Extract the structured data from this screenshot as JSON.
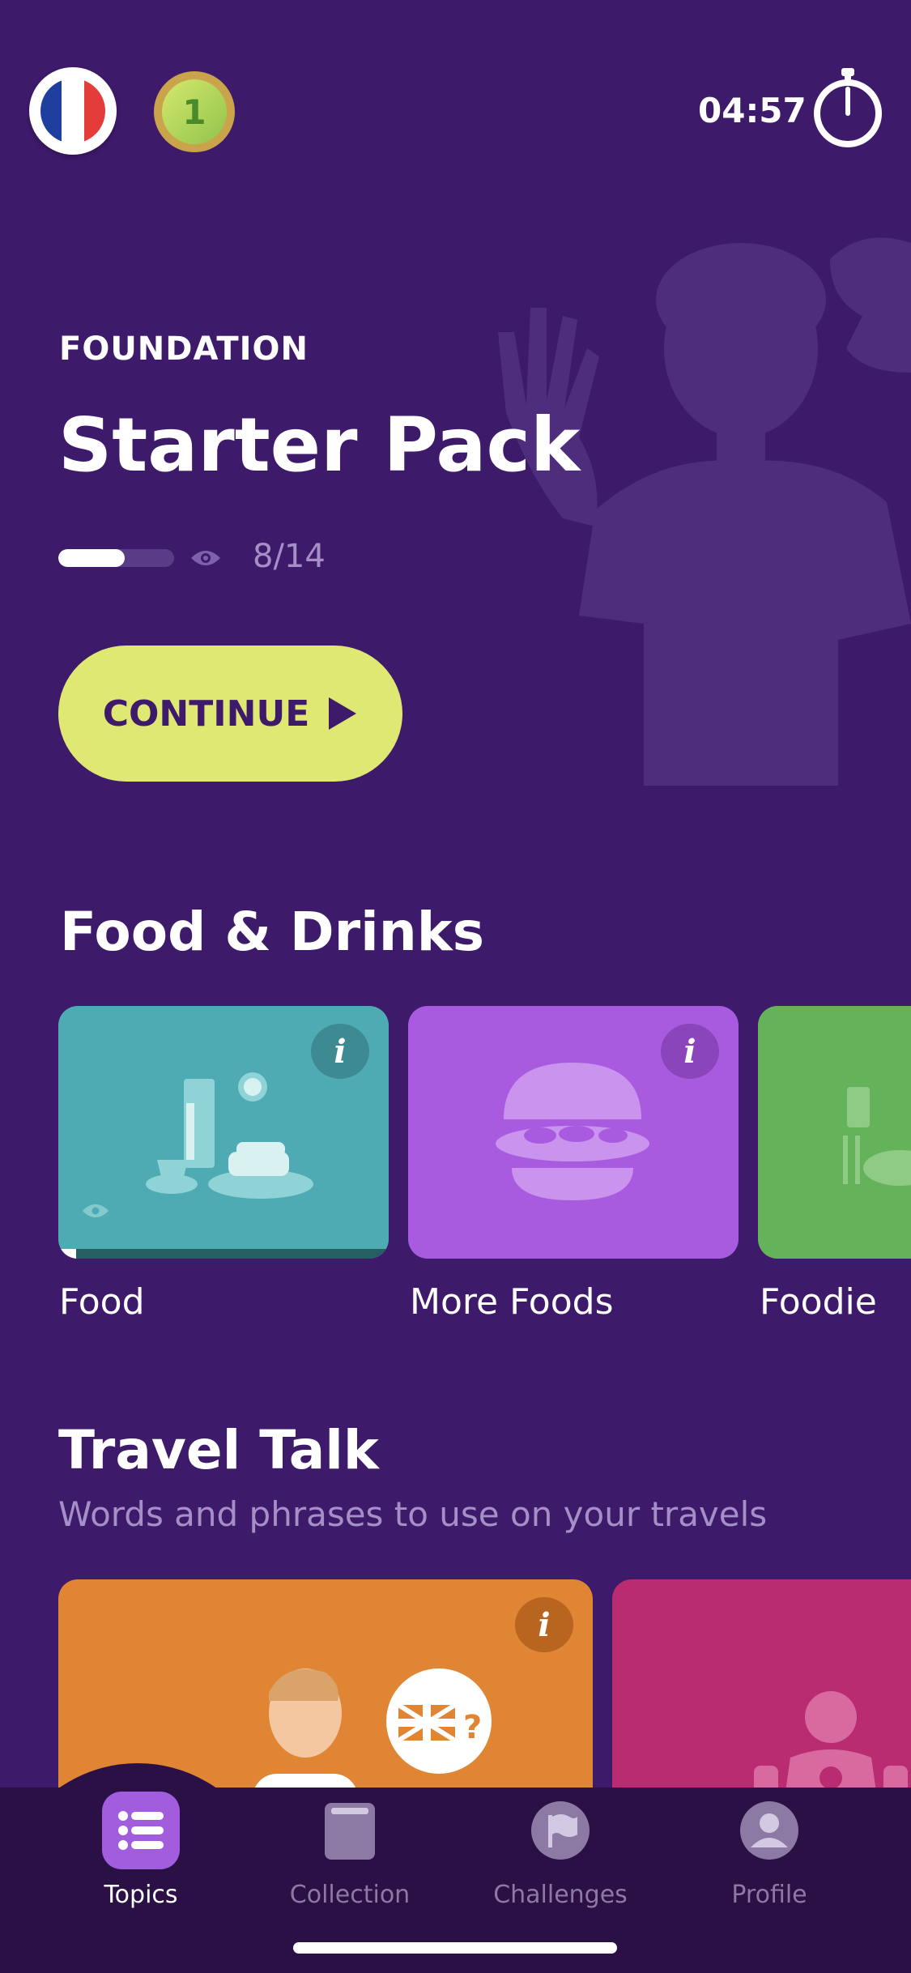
{
  "header": {
    "flag_icon": "france-flag-icon",
    "level_badge": "1",
    "timer": "04:57",
    "timer_icon": "stopwatch-icon"
  },
  "hero": {
    "kicker": "FOUNDATION",
    "title": "Starter Pack",
    "progress_text": "8/14",
    "progress_fraction": 0.57,
    "continue_label": "CONTINUE"
  },
  "food_section": {
    "title": "Food & Drinks",
    "cards": [
      {
        "label": "Food",
        "color": "#4eabb3"
      },
      {
        "label": "More Foods",
        "color": "#a95be0"
      },
      {
        "label": "Foodie",
        "color": "#64b35a"
      }
    ]
  },
  "travel_section": {
    "title": "Travel Talk",
    "subtitle": "Words and phrases to use on your travels",
    "cards": [
      {
        "color": "#e08533"
      },
      {
        "color": "#b92c72"
      }
    ]
  },
  "nav": {
    "items": [
      {
        "label": "Topics",
        "icon": "list-icon",
        "active": true
      },
      {
        "label": "Collection",
        "icon": "book-icon",
        "active": false
      },
      {
        "label": "Challenges",
        "icon": "flag-icon",
        "active": false
      },
      {
        "label": "Profile",
        "icon": "profile-icon",
        "active": false
      }
    ]
  },
  "colors": {
    "background": "#3e1a6b",
    "accent": "#dfe873",
    "nav_bar": "#2a1044",
    "nav_active": "#a15ddd"
  }
}
